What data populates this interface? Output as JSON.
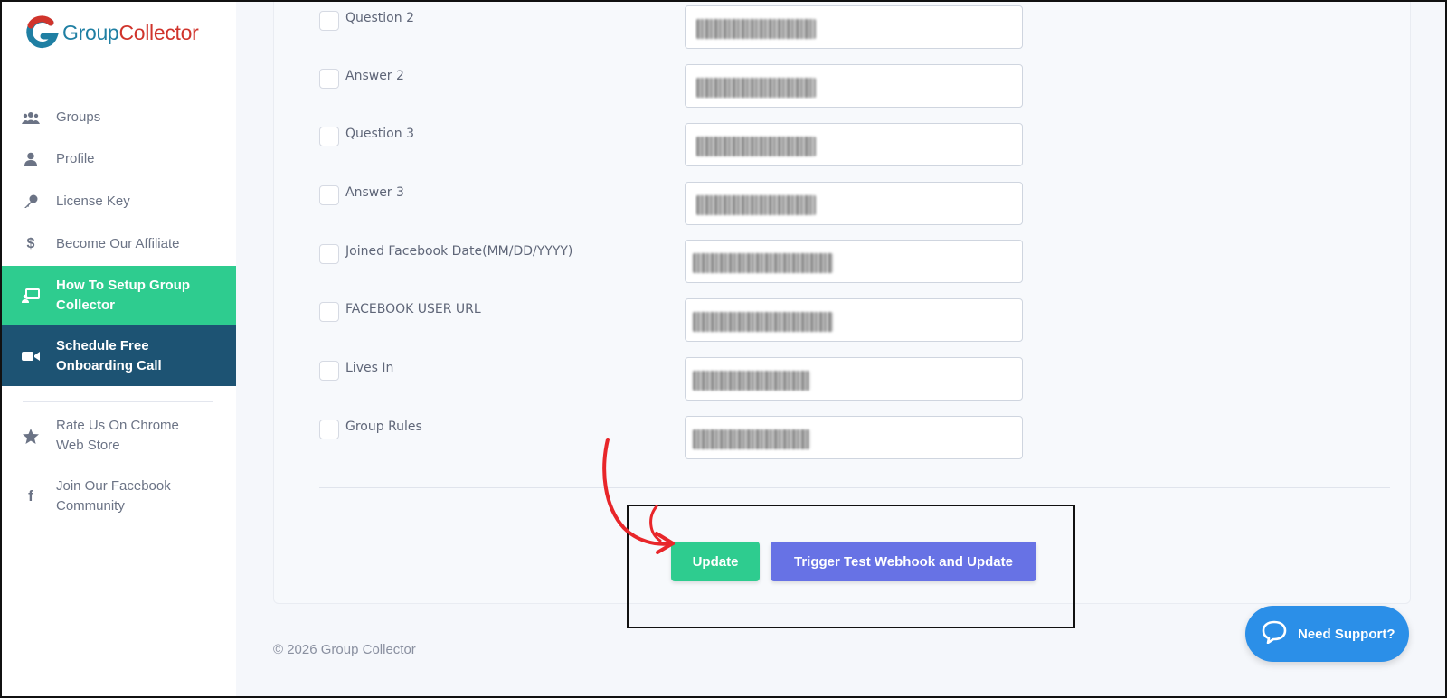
{
  "brand": {
    "name_part1": "Group",
    "name_part2": "Collector"
  },
  "sidebar": {
    "items": [
      {
        "label": "Groups",
        "icon": "users-icon"
      },
      {
        "label": "Profile",
        "icon": "user-icon"
      },
      {
        "label": "License Key",
        "icon": "key-icon"
      },
      {
        "label": "Become Our Affiliate",
        "icon": "dollar-icon"
      },
      {
        "label": "How To Setup Group Collector",
        "icon": "screen-user-icon"
      },
      {
        "label": "Schedule Free Onboarding Call",
        "icon": "video-camera-icon"
      },
      {
        "label": "Rate Us On Chrome Web Store",
        "icon": "star-icon"
      },
      {
        "label": "Join Our Facebook Community",
        "icon": "facebook-icon"
      }
    ]
  },
  "form": {
    "rows": [
      {
        "label": "Question 2"
      },
      {
        "label": "Answer 2"
      },
      {
        "label": "Question 3"
      },
      {
        "label": "Answer 3"
      },
      {
        "label": "Joined Facebook Date(MM/DD/YYYY)"
      },
      {
        "label": "FACEBOOK USER URL"
      },
      {
        "label": "Lives In"
      },
      {
        "label": "Group Rules"
      }
    ],
    "update_label": "Update",
    "trigger_label": "Trigger Test Webhook and Update"
  },
  "footer": {
    "copyright": "© 2026 Group Collector"
  },
  "support": {
    "label": "Need Support?"
  },
  "colors": {
    "accent_green": "#2ecc8f",
    "accent_dark_blue": "#1d5373",
    "accent_indigo": "#6772e5",
    "support_blue": "#2b8fe8",
    "annotation_red": "#e8262a"
  }
}
